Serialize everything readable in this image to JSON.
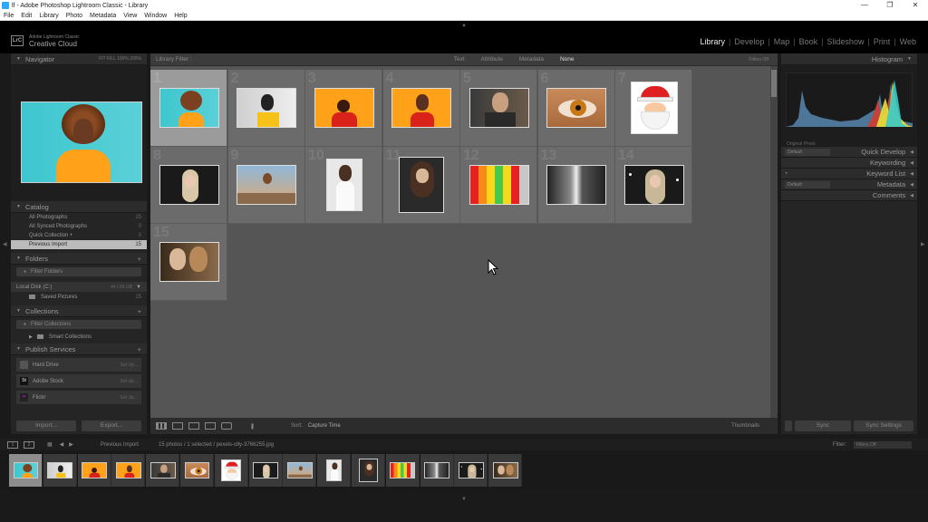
{
  "window": {
    "title": "lf - Adobe Photoshop Lightroom Classic - Library",
    "controls": [
      "—",
      "❐",
      "✕"
    ]
  },
  "menu": [
    "File",
    "Edit",
    "Library",
    "Photo",
    "Metadata",
    "View",
    "Window",
    "Help"
  ],
  "identity": {
    "logo": "LrC",
    "line1": "Adobe Lightroom Classic",
    "line2": "Creative Cloud"
  },
  "modules": [
    {
      "label": "Library",
      "active": true
    },
    {
      "label": "Develop"
    },
    {
      "label": "Map"
    },
    {
      "label": "Book"
    },
    {
      "label": "Slideshow"
    },
    {
      "label": "Print"
    },
    {
      "label": "Web"
    }
  ],
  "left": {
    "navigator": {
      "title": "Navigator",
      "zoom_opts": "FIT  FILL  100%  200%"
    },
    "catalog": {
      "title": "Catalog",
      "items": [
        {
          "label": "All Photographs",
          "count": "15"
        },
        {
          "label": "All Synced Photographs",
          "count": "0"
        },
        {
          "label": "Quick Collection +",
          "count": "0"
        },
        {
          "label": "Previous Import",
          "count": "15",
          "selected": true
        }
      ]
    },
    "folders": {
      "title": "Folders",
      "filter": "Filter Folders",
      "disk": "Local Disk (C:)",
      "disk_meter": "44 / 99 GB",
      "folder": {
        "label": "Saved Pictures",
        "count": "15"
      }
    },
    "collections": {
      "title": "Collections",
      "filter": "Filter Collections",
      "item": "Smart Collections"
    },
    "publish": {
      "title": "Publish Services",
      "services": [
        {
          "label": "Hard Drive",
          "icon": "",
          "setup": "Set Up..."
        },
        {
          "label": "Adobe Stock",
          "icon": "St",
          "setup": "Set Up..."
        },
        {
          "label": "Flickr",
          "icon": "••",
          "setup": "Set Up..."
        }
      ]
    },
    "import_label": "Import...",
    "export_label": "Export..."
  },
  "center": {
    "filterbar": {
      "title": "Library Filter :",
      "options": [
        {
          "label": "Text"
        },
        {
          "label": "Attribute"
        },
        {
          "label": "Metadata"
        },
        {
          "label": "None",
          "active": true
        }
      ],
      "filters_off": "Filters Off"
    },
    "photos": [
      {
        "num": "1",
        "kind": "afro",
        "selected": true
      },
      {
        "num": "2",
        "kind": "headphones-grey"
      },
      {
        "num": "3",
        "kind": "red-orange"
      },
      {
        "num": "4",
        "kind": "headphones-orange"
      },
      {
        "num": "5",
        "kind": "bald-portrait"
      },
      {
        "num": "6",
        "kind": "eye"
      },
      {
        "num": "7",
        "kind": "santa"
      },
      {
        "num": "8",
        "kind": "blonde-dark"
      },
      {
        "num": "9",
        "kind": "balloon"
      },
      {
        "num": "10",
        "kind": "white-dress"
      },
      {
        "num": "11",
        "kind": "curly-dark"
      },
      {
        "num": "12",
        "kind": "color-bars"
      },
      {
        "num": "13",
        "kind": "waterfall"
      },
      {
        "num": "14",
        "kind": "blonde-lights"
      },
      {
        "num": "15",
        "kind": "couple"
      }
    ],
    "toolbar": {
      "sort_label": "Sort:",
      "sort_value": "Capture Time",
      "thumbnails": "Thumbnails"
    }
  },
  "right": {
    "histogram": "Histogram",
    "original_photo": "Original Photo",
    "quick_develop": {
      "preset": "Default",
      "label": "Quick Develop"
    },
    "keywording": "Keywording",
    "keyword_list": "Keyword List",
    "metadata": {
      "preset": "Default",
      "label": "Metadata"
    },
    "comments": "Comments",
    "sync_label": "Sync",
    "sync_settings_label": "Sync Settings"
  },
  "filmstrip": {
    "source": "Previous Import",
    "info": "15 photos / 1 selected / pexels-olly-3766255.jpg",
    "filter_label": "Filter:",
    "filter_value": "Filters Off"
  }
}
